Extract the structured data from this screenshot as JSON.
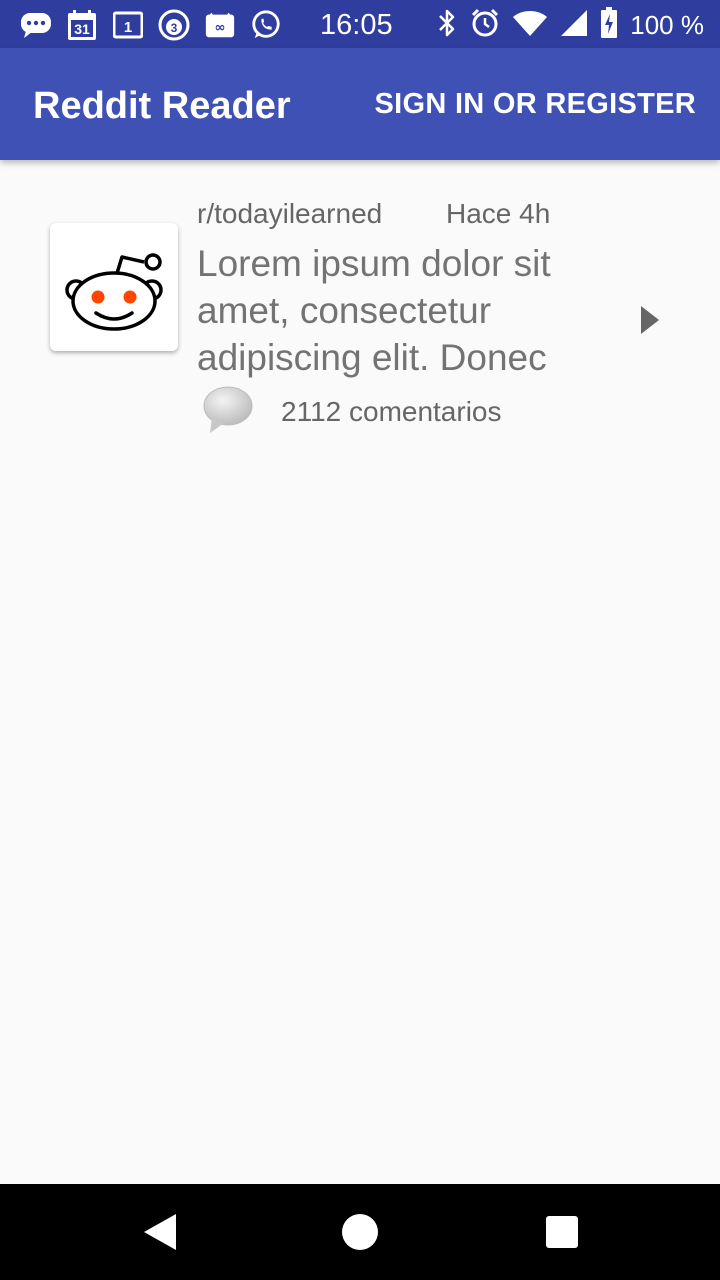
{
  "status_bar": {
    "time": "16:05",
    "battery_pct": "100 %",
    "calendar_day": "31",
    "notif_count": "1",
    "ball_number": "3",
    "icons_left": [
      "chat-bubble-icon",
      "calendar-icon",
      "notification-count-icon",
      "ball-icon",
      "voicemail-icon",
      "whatsapp-icon"
    ],
    "icons_right": [
      "bluetooth-icon",
      "alarm-icon",
      "wifi-icon",
      "cell-signal-icon",
      "battery-icon"
    ]
  },
  "app_bar": {
    "title": "Reddit Reader",
    "action": "SIGN IN OR REGISTER",
    "color": "#3f51b5"
  },
  "posts": [
    {
      "subreddit": "r/todayilearned",
      "time": "Hace 4h",
      "title": "Lorem ipsum dolor sit amet, consectetur adipiscing elit. Donec",
      "comments": "2112 comentarios",
      "thumbnail": "reddit-alien-icon"
    }
  ],
  "nav_bar": {
    "buttons": [
      "back-icon",
      "home-icon",
      "recents-icon"
    ]
  }
}
